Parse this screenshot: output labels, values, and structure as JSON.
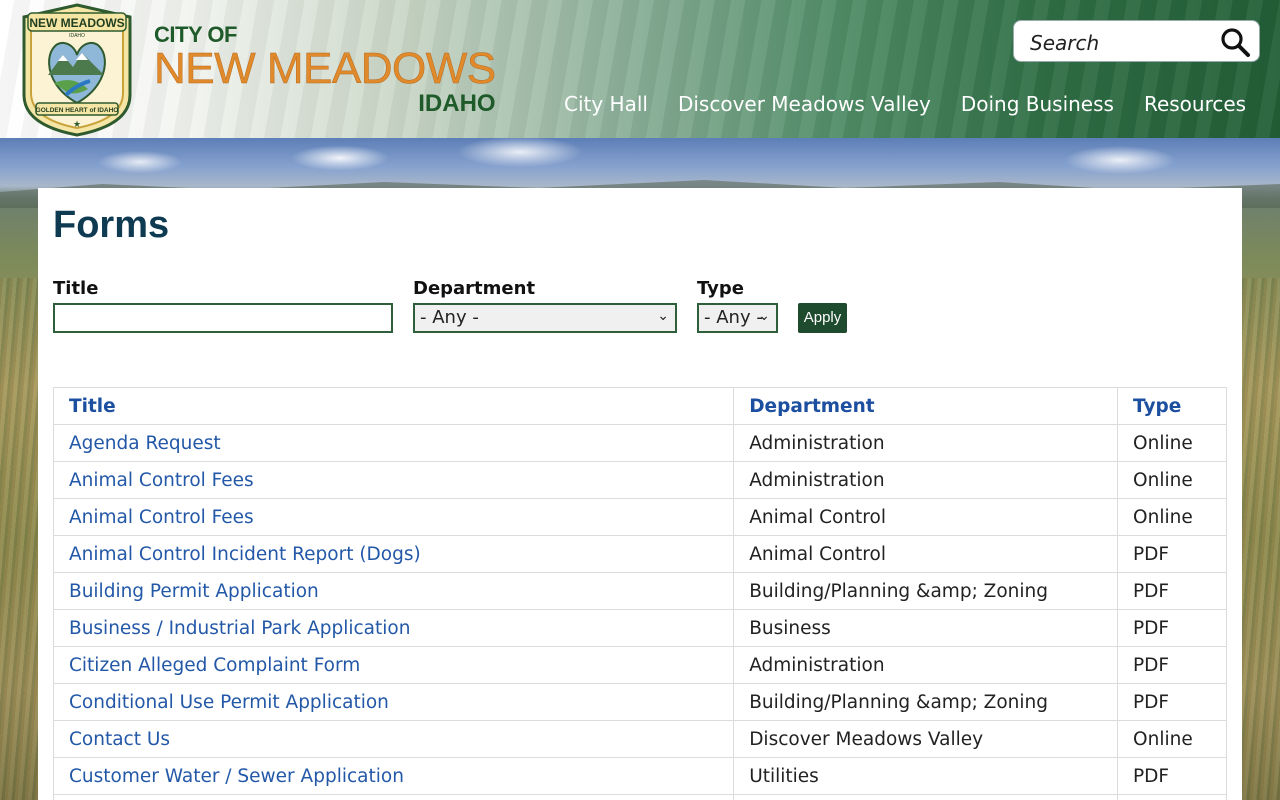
{
  "header": {
    "seal": {
      "top_text": "NEW MEADOWS",
      "sub_text": "IDAHO",
      "bottom_text": "GOLDEN HEART of IDAHO"
    },
    "brand": {
      "line1": "CITY OF",
      "line2": "NEW MEADOWS",
      "line3": "IDAHO"
    },
    "search": {
      "placeholder": "Search"
    },
    "nav": [
      "City Hall",
      "Discover Meadows Valley",
      "Doing Business",
      "Resources"
    ]
  },
  "main": {
    "title": "Forms",
    "filters": {
      "title_label": "Title",
      "title_value": "",
      "department_label": "Department",
      "department_value": "- Any -",
      "type_label": "Type",
      "type_value": "- Any -",
      "apply_label": "Apply"
    },
    "table": {
      "headers": [
        "Title",
        "Department",
        "Type"
      ],
      "rows": [
        [
          "Agenda Request",
          "Administration",
          "Online"
        ],
        [
          "Animal Control Fees",
          "Administration",
          "Online"
        ],
        [
          "Animal Control Fees",
          "Animal Control",
          "Online"
        ],
        [
          "Animal Control Incident Report (Dogs)",
          "Animal Control",
          "PDF"
        ],
        [
          "Building Permit Application",
          "Building/Planning &amp; Zoning",
          "PDF"
        ],
        [
          "Business / Industrial Park Application",
          "Business",
          "PDF"
        ],
        [
          "Citizen Alleged Complaint Form",
          "Administration",
          "PDF"
        ],
        [
          "Conditional Use Permit Application",
          "Building/Planning &amp; Zoning",
          "PDF"
        ],
        [
          "Contact Us",
          "Discover Meadows Valley",
          "Online"
        ],
        [
          "Customer Water / Sewer Application",
          "Utilities",
          "PDF"
        ],
        [
          "",
          "",
          ""
        ]
      ]
    }
  },
  "colors": {
    "accent": "#1e4a2d",
    "link": "#2358a8",
    "title": "#0e3a52",
    "brand_orange": "#e08a2c"
  }
}
